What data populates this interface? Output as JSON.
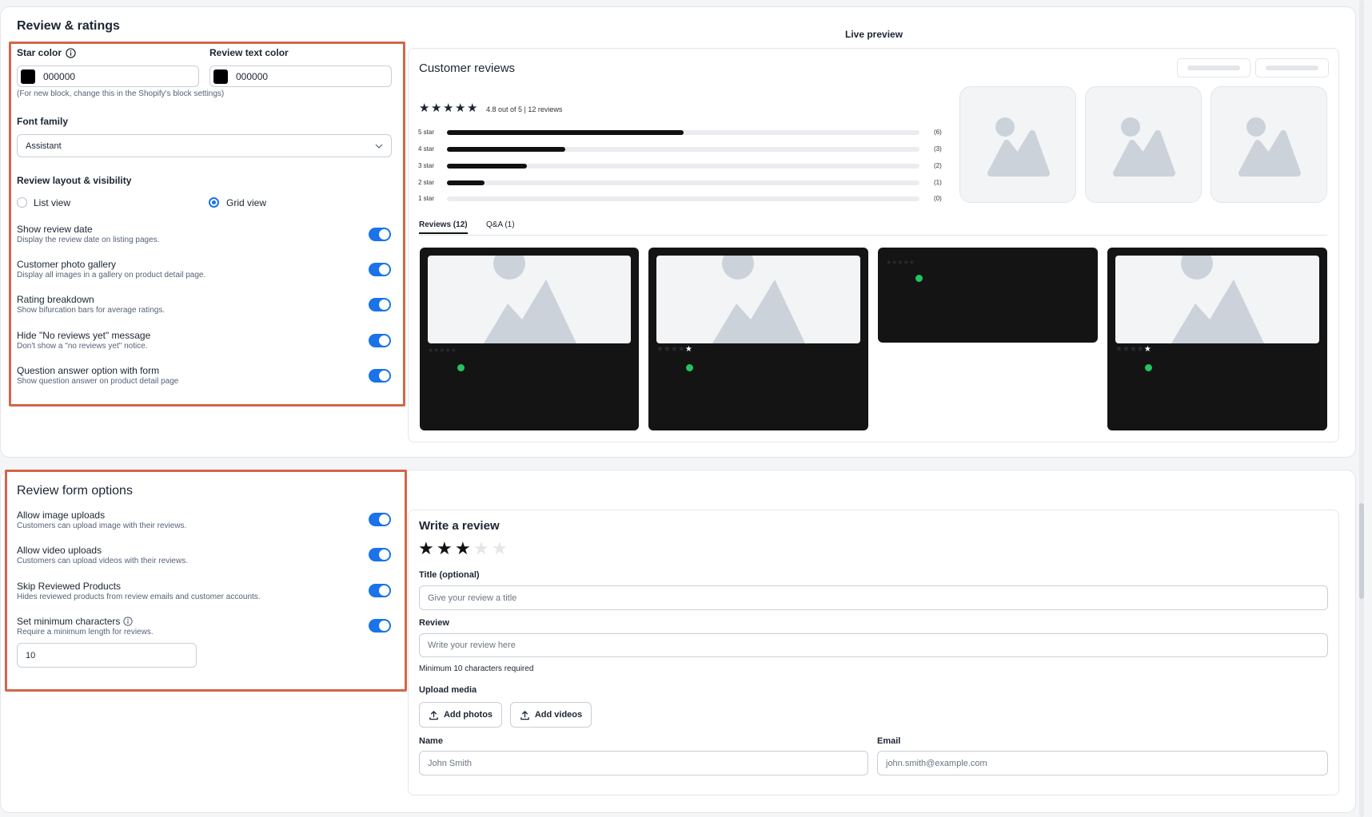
{
  "review_ratings": {
    "title": "Review & ratings",
    "star_color_label": "Star color",
    "star_color_value": "000000",
    "review_text_color_label": "Review text color",
    "review_text_color_value": "000000",
    "color_hint": "(For new block, change this in the Shopify's block settings)",
    "font_family_label": "Font family",
    "font_family_value": "Assistant",
    "layout_label": "Review layout & visibility",
    "list_view": "List view",
    "grid_view": "Grid view",
    "toggles": [
      {
        "title": "Show review date",
        "desc": "Display the review date on listing pages."
      },
      {
        "title": "Customer photo gallery",
        "desc": "Display all images in a gallery on product detail page."
      },
      {
        "title": "Rating breakdown",
        "desc": "Show bifurcation bars for average ratings."
      },
      {
        "title": "Hide \"No reviews yet\" message",
        "desc": "Don't show a \"no reviews yet\" notice."
      },
      {
        "title": "Question answer option with form",
        "desc": "Show question answer on product detail page"
      }
    ]
  },
  "preview": {
    "live_preview": "Live preview",
    "customer_reviews": "Customer reviews",
    "summary": "4.8 out of 5 | 12 reviews",
    "rating_rows": [
      {
        "label": "5 star",
        "count": "(6)",
        "fraction": 0.5
      },
      {
        "label": "4 star",
        "count": "(3)",
        "fraction": 0.25
      },
      {
        "label": "3 star",
        "count": "(2)",
        "fraction": 0.17
      },
      {
        "label": "2 star",
        "count": "(1)",
        "fraction": 0.08
      },
      {
        "label": "1 star",
        "count": "(0)",
        "fraction": 0
      }
    ],
    "tabs": [
      "Reviews (12)",
      "Q&A (1)"
    ]
  },
  "form_options": {
    "title": "Review form options",
    "toggles": [
      {
        "title": "Allow image uploads",
        "desc": "Customers can upload image with their reviews."
      },
      {
        "title": "Allow video uploads",
        "desc": "Customers can upload videos with their reviews."
      },
      {
        "title": "Skip Reviewed Products",
        "desc": "Hides reviewed products from review emails and customer accounts."
      },
      {
        "title": "Set minimum characters",
        "desc": "Require a minimum length for reviews."
      }
    ],
    "min_chars_value": "10"
  },
  "write_review": {
    "title": "Write a review",
    "rating": 3,
    "title_label": "Title (optional)",
    "title_placeholder": "Give your review a title",
    "review_label": "Review",
    "review_placeholder": "Write your review here",
    "min_hint": "Minimum 10 characters required",
    "upload_label": "Upload media",
    "add_photos": "Add photos",
    "add_videos": "Add videos",
    "name_label": "Name",
    "name_placeholder": "John Smith",
    "email_label": "Email",
    "email_placeholder": "john.smith@example.com"
  },
  "colors": {
    "accent": "#1a73e8",
    "highlight_border": "#d2664b",
    "star": "#000000"
  }
}
